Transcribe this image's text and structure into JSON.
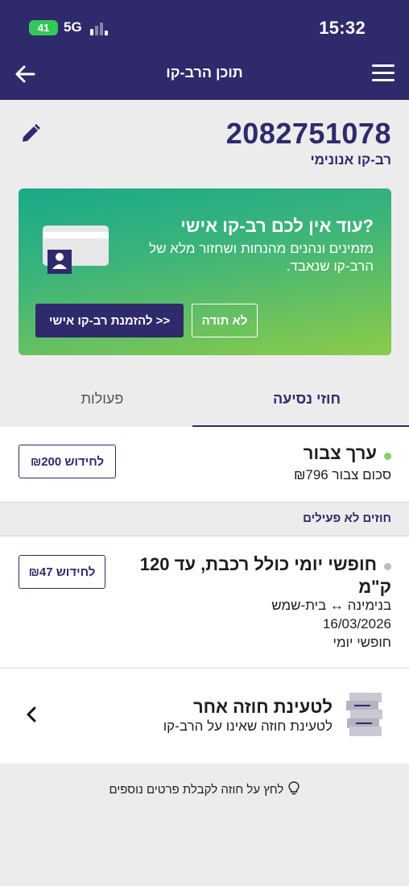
{
  "status": {
    "time": "15:32",
    "network": "5G",
    "battery": "41"
  },
  "header": {
    "title": "תוכן הרב-קו"
  },
  "card": {
    "number": "2082751078",
    "type": "רב-קו אנונימי"
  },
  "promo": {
    "title": "עוד אין לכם רב-קו אישי?",
    "body": "מזמינים ונהנים מהנחות ושחזור מלא של הרב-קו שנאבד.",
    "dismiss_label": "לא תודה",
    "order_label": "להזמנת רב-קו אישי >>"
  },
  "tabs": [
    {
      "label": "חוזי נסיעה",
      "active": true
    },
    {
      "label": "פעולות",
      "active": false
    }
  ],
  "stored_value": {
    "title": "ערך צבור",
    "amount": "סכום צבור ₪796",
    "renew_label": "לחידוש ₪200",
    "status_color": "#7ed36a"
  },
  "inactive_section": {
    "title": "חוזים לא פעילים"
  },
  "contract": {
    "title_line1": "חופשי יומי כולל רכבת, עד 120",
    "title_line2": "ק\"מ",
    "route": "בנימינה ↔ בית-שמש",
    "date": "16/03/2026",
    "type": "חופשי יומי",
    "renew_label": "לחידוש ₪47",
    "status_color": "#bdbdbd"
  },
  "load_other": {
    "title": "לטעינת חוזה אחר",
    "subtitle": "לטעינת חוזה שאינו על הרב-קו"
  },
  "hint": "לחץ על חוזה לקבלת פרטים נוספים",
  "colors": {
    "brand": "#2e2a6b",
    "promo_start": "#1aa98a",
    "promo_end": "#8ccb4a"
  }
}
